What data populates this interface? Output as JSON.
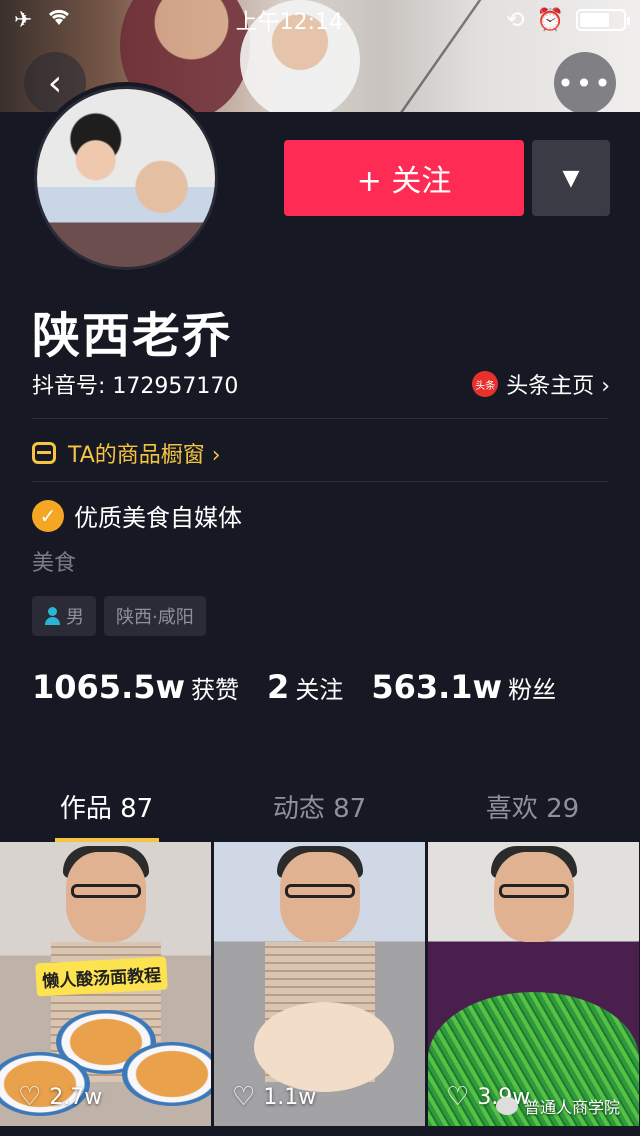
{
  "statusbar": {
    "time": "上午12:14"
  },
  "profile": {
    "name": "陕西老乔",
    "douyin_id": "抖音号: 172957170",
    "toutiao_badge": "头条",
    "toutiao_link": "头条主页 ›",
    "shop_link": "TA的商品橱窗 ›",
    "verified_text": "优质美食自媒体",
    "category": "美食",
    "tags": {
      "gender": "男",
      "location": "陕西·咸阳"
    },
    "follow_label": "+ 关注",
    "stats": {
      "likes_num": "1065.5w",
      "likes_label": "获赞",
      "following_num": "2",
      "following_label": "关注",
      "fans_num": "563.1w",
      "fans_label": "粉丝"
    }
  },
  "tabs": [
    {
      "label": "作品 87",
      "active": true
    },
    {
      "label": "动态 87",
      "active": false
    },
    {
      "label": "喜欢 29",
      "active": false
    }
  ],
  "videos": [
    {
      "caption": "懒人酸汤面教程",
      "likes": "2.7w"
    },
    {
      "likes": "1.1w"
    },
    {
      "likes": "3.9w"
    }
  ],
  "watermark": "普通人商学院",
  "colors": {
    "follow": "#fe2c55",
    "accent": "#f5c443",
    "background": "#161823",
    "verified": "#f5a623"
  },
  "icons": [
    "back-icon",
    "more-icon",
    "dropdown-icon",
    "shop-icon",
    "verified-icon",
    "person-icon",
    "heart-icon"
  ]
}
